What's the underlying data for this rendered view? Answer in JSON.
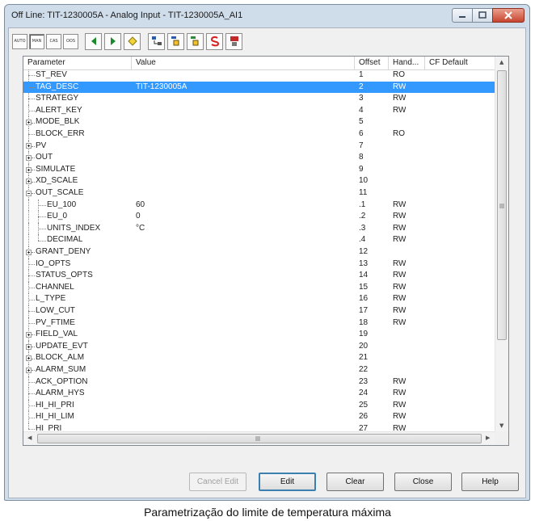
{
  "window": {
    "title": "Off Line: TIT-1230005A - Analog Input - TIT-1230005A_AI1"
  },
  "toolbar": {
    "mode_buttons": [
      "AUTO",
      "MAN",
      "CAS",
      "OOS"
    ],
    "selected_mode": "MAN"
  },
  "table": {
    "columns": [
      "Parameter",
      "Value",
      "Offset",
      "Hand...",
      "CF Default"
    ],
    "rows": [
      {
        "name": "ST_REV",
        "value": "",
        "offset": "1",
        "hand": "RO",
        "level": 0,
        "expander": "none",
        "selected": false
      },
      {
        "name": "TAG_DESC",
        "value": "TIT-1230005A",
        "offset": "2",
        "hand": "RW",
        "level": 0,
        "expander": "none",
        "selected": true
      },
      {
        "name": "STRATEGY",
        "value": "",
        "offset": "3",
        "hand": "RW",
        "level": 0,
        "expander": "none",
        "selected": false
      },
      {
        "name": "ALERT_KEY",
        "value": "",
        "offset": "4",
        "hand": "RW",
        "level": 0,
        "expander": "none",
        "selected": false
      },
      {
        "name": "MODE_BLK",
        "value": "",
        "offset": "5",
        "hand": "",
        "level": 0,
        "expander": "plus",
        "selected": false
      },
      {
        "name": "BLOCK_ERR",
        "value": "",
        "offset": "6",
        "hand": "RO",
        "level": 0,
        "expander": "none",
        "selected": false
      },
      {
        "name": "PV",
        "value": "",
        "offset": "7",
        "hand": "",
        "level": 0,
        "expander": "plus",
        "selected": false
      },
      {
        "name": "OUT",
        "value": "",
        "offset": "8",
        "hand": "",
        "level": 0,
        "expander": "plus",
        "selected": false
      },
      {
        "name": "SIMULATE",
        "value": "",
        "offset": "9",
        "hand": "",
        "level": 0,
        "expander": "plus",
        "selected": false
      },
      {
        "name": "XD_SCALE",
        "value": "",
        "offset": "10",
        "hand": "",
        "level": 0,
        "expander": "plus",
        "selected": false
      },
      {
        "name": "OUT_SCALE",
        "value": "",
        "offset": "11",
        "hand": "",
        "level": 0,
        "expander": "minus",
        "selected": false
      },
      {
        "name": "EU_100",
        "value": "60",
        "offset": ".1",
        "hand": "RW",
        "level": 1,
        "expander": "none",
        "selected": false
      },
      {
        "name": "EU_0",
        "value": "0",
        "offset": ".2",
        "hand": "RW",
        "level": 1,
        "expander": "none",
        "selected": false
      },
      {
        "name": "UNITS_INDEX",
        "value": "°C",
        "offset": ".3",
        "hand": "RW",
        "level": 1,
        "expander": "none",
        "selected": false
      },
      {
        "name": "DECIMAL",
        "value": "",
        "offset": ".4",
        "hand": "RW",
        "level": 1,
        "expander": "none",
        "selected": false
      },
      {
        "name": "GRANT_DENY",
        "value": "",
        "offset": "12",
        "hand": "",
        "level": 0,
        "expander": "plus",
        "selected": false
      },
      {
        "name": "IO_OPTS",
        "value": "",
        "offset": "13",
        "hand": "RW",
        "level": 0,
        "expander": "none",
        "selected": false
      },
      {
        "name": "STATUS_OPTS",
        "value": "",
        "offset": "14",
        "hand": "RW",
        "level": 0,
        "expander": "none",
        "selected": false
      },
      {
        "name": "CHANNEL",
        "value": "",
        "offset": "15",
        "hand": "RW",
        "level": 0,
        "expander": "none",
        "selected": false
      },
      {
        "name": "L_TYPE",
        "value": "",
        "offset": "16",
        "hand": "RW",
        "level": 0,
        "expander": "none",
        "selected": false
      },
      {
        "name": "LOW_CUT",
        "value": "",
        "offset": "17",
        "hand": "RW",
        "level": 0,
        "expander": "none",
        "selected": false
      },
      {
        "name": "PV_FTIME",
        "value": "",
        "offset": "18",
        "hand": "RW",
        "level": 0,
        "expander": "none",
        "selected": false
      },
      {
        "name": "FIELD_VAL",
        "value": "",
        "offset": "19",
        "hand": "",
        "level": 0,
        "expander": "plus",
        "selected": false
      },
      {
        "name": "UPDATE_EVT",
        "value": "",
        "offset": "20",
        "hand": "",
        "level": 0,
        "expander": "plus",
        "selected": false
      },
      {
        "name": "BLOCK_ALM",
        "value": "",
        "offset": "21",
        "hand": "",
        "level": 0,
        "expander": "plus",
        "selected": false
      },
      {
        "name": "ALARM_SUM",
        "value": "",
        "offset": "22",
        "hand": "",
        "level": 0,
        "expander": "plus",
        "selected": false
      },
      {
        "name": "ACK_OPTION",
        "value": "",
        "offset": "23",
        "hand": "RW",
        "level": 0,
        "expander": "none",
        "selected": false
      },
      {
        "name": "ALARM_HYS",
        "value": "",
        "offset": "24",
        "hand": "RW",
        "level": 0,
        "expander": "none",
        "selected": false
      },
      {
        "name": "HI_HI_PRI",
        "value": "",
        "offset": "25",
        "hand": "RW",
        "level": 0,
        "expander": "none",
        "selected": false
      },
      {
        "name": "HI_HI_LIM",
        "value": "",
        "offset": "26",
        "hand": "RW",
        "level": 0,
        "expander": "none",
        "selected": false
      },
      {
        "name": "HI_PRI",
        "value": "",
        "offset": "27",
        "hand": "RW",
        "level": 0,
        "expander": "none",
        "selected": false
      }
    ]
  },
  "buttons": {
    "cancel_edit": "Cancel Edit",
    "edit": "Edit",
    "clear": "Clear",
    "close": "Close",
    "help": "Help"
  },
  "caption": "Parametrização do limite de temperatura máxima",
  "colors": {
    "selection": "#3399ff",
    "window_frame": "#cfdcea",
    "close_button": "#c8452f"
  }
}
